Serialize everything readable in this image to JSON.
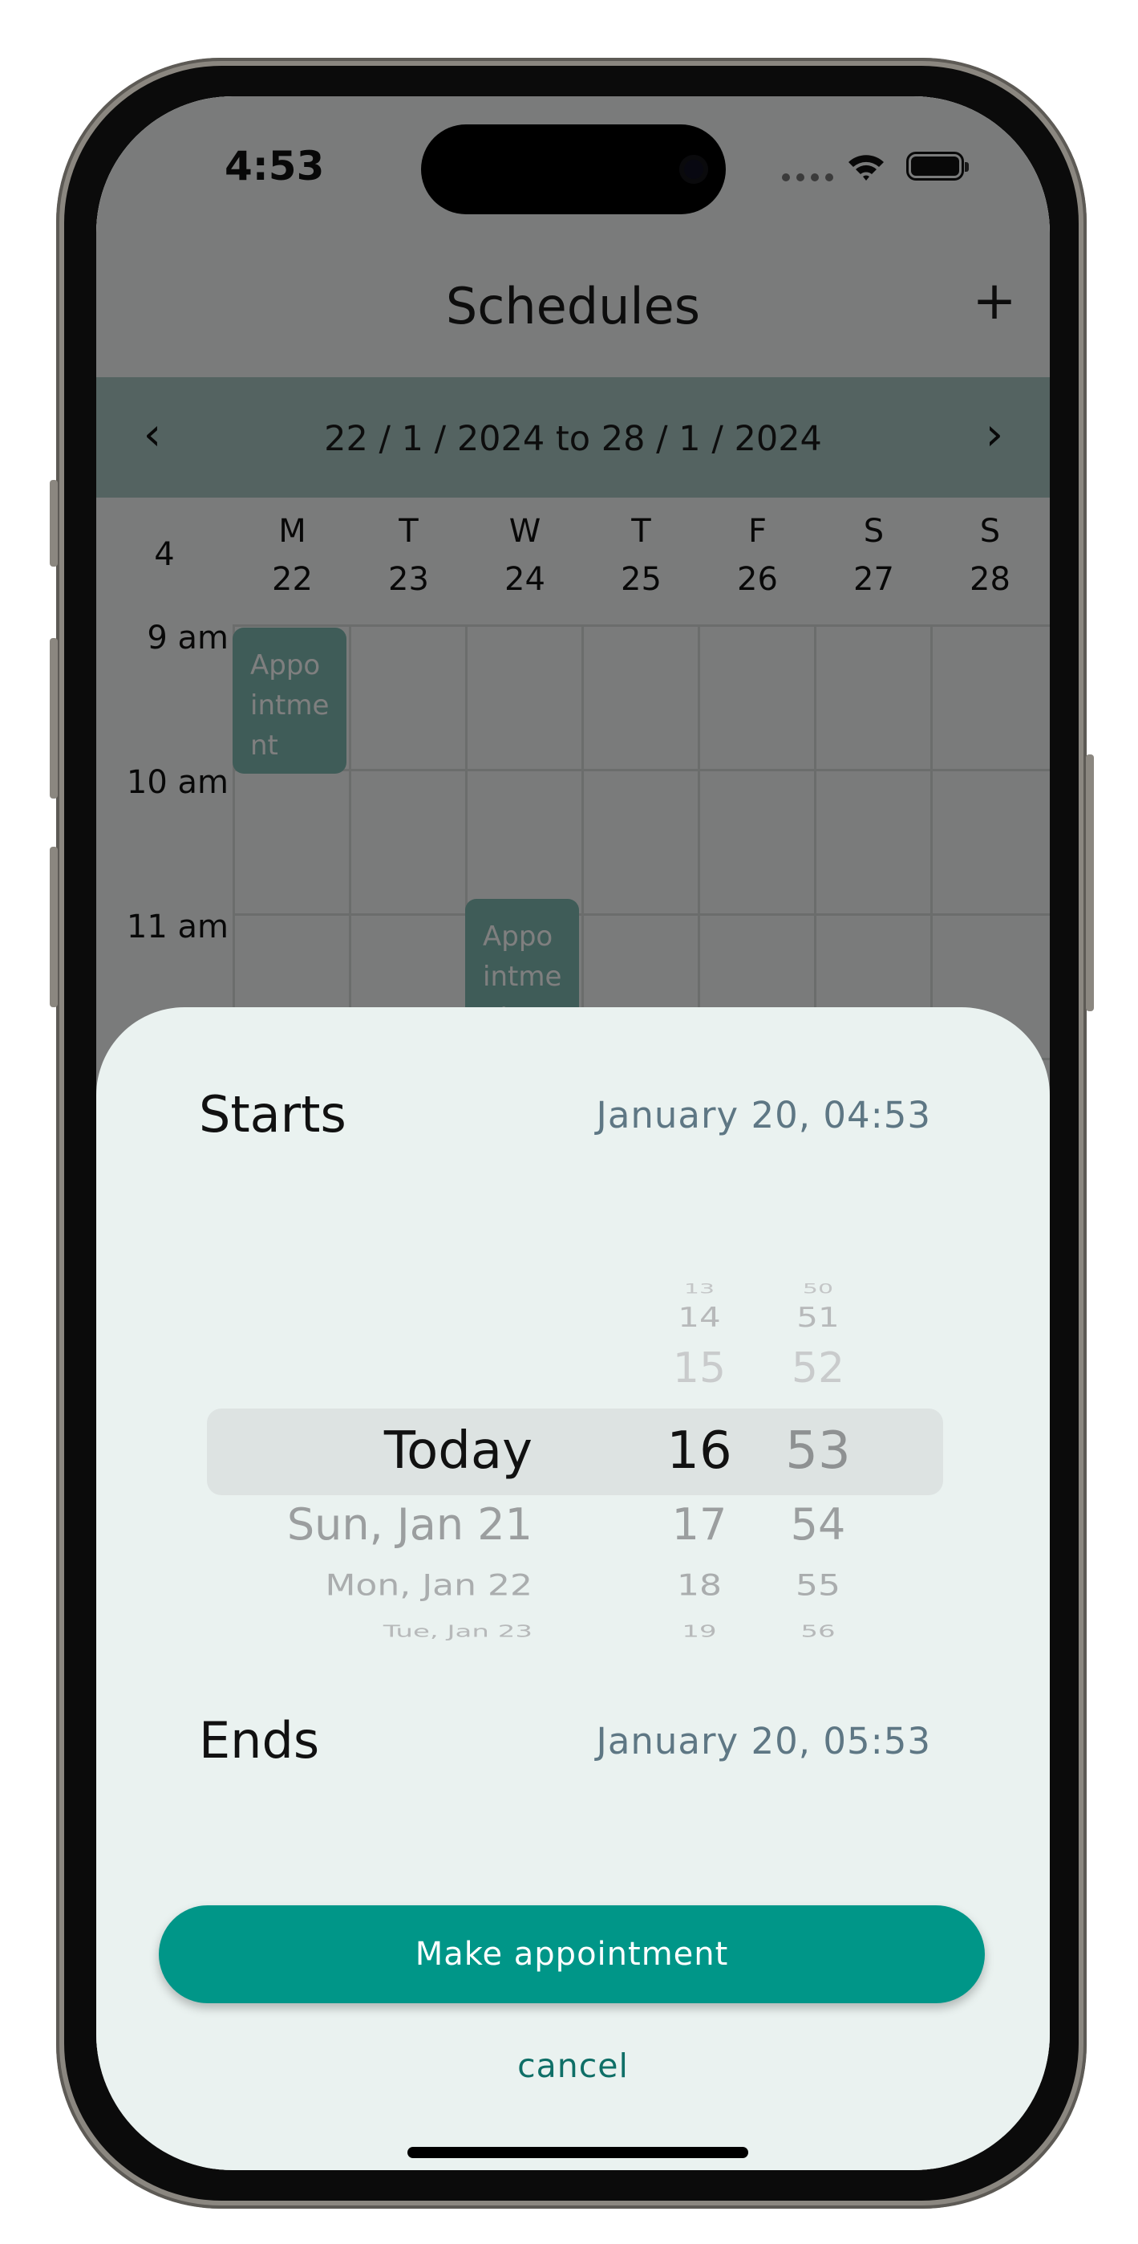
{
  "status": {
    "time": "4:53"
  },
  "header": {
    "title": "Schedules",
    "add_icon": "+"
  },
  "week": {
    "prev_icon": "‹",
    "range": "22 / 1 / 2024 to 28 / 1 / 2024",
    "next_icon": "›"
  },
  "calendar": {
    "week_number": "4",
    "days": [
      {
        "letter": "M",
        "date": "22"
      },
      {
        "letter": "T",
        "date": "23"
      },
      {
        "letter": "W",
        "date": "24"
      },
      {
        "letter": "T",
        "date": "25"
      },
      {
        "letter": "F",
        "date": "26"
      },
      {
        "letter": "S",
        "date": "27"
      },
      {
        "letter": "S",
        "date": "28"
      }
    ],
    "hours": [
      "9 am",
      "10 am",
      "11 am"
    ],
    "appointments": [
      {
        "text": "Appo intme nt"
      },
      {
        "text": "Appo intme nt"
      }
    ]
  },
  "sheet": {
    "starts_label": "Starts",
    "starts_value": "January 20, 04:53",
    "ends_label": "Ends",
    "ends_value": "January 20, 05:53",
    "picker": {
      "dates": [
        "Today",
        "Sun, Jan 21",
        "Mon, Jan 22",
        "Tue, Jan 23"
      ],
      "hours": [
        "13",
        "14",
        "15",
        "16",
        "17",
        "18",
        "19"
      ],
      "minutes": [
        "50",
        "51",
        "52",
        "53",
        "54",
        "55",
        "56"
      ],
      "selected_date": "Today",
      "selected_hour": "16",
      "selected_minute": "53"
    },
    "make_button": "Make appointment",
    "cancel": "cancel"
  },
  "colors": {
    "accent": "#009688",
    "week_bar": "#a8c6c3",
    "sheet_bg": "#eaf2f0",
    "appointment": "#7fb9b0"
  }
}
